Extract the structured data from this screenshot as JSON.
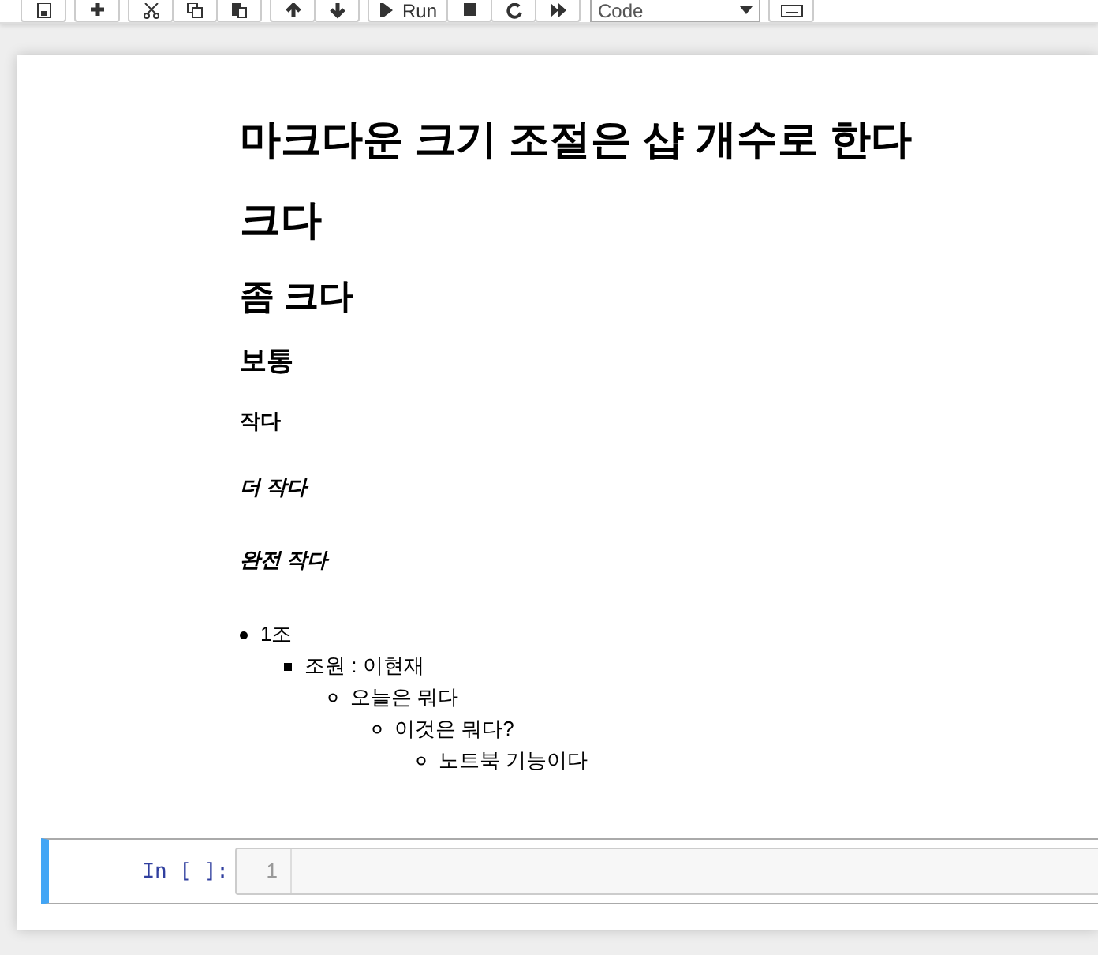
{
  "toolbar": {
    "run_label": "Run",
    "cell_type": "Code"
  },
  "markdown": {
    "headings": [
      {
        "kind": "h1",
        "text": "마크다운 크기 조절은 샵 개수로 한다"
      },
      {
        "kind": "h1",
        "text": "크다"
      },
      {
        "kind": "h2",
        "text": "좀 크다"
      },
      {
        "kind": "h3",
        "text": "보통"
      },
      {
        "kind": "h4",
        "text": "작다"
      },
      {
        "kind": "h5",
        "text": "더 작다"
      },
      {
        "kind": "h6",
        "text": "완전 작다"
      }
    ],
    "list": [
      {
        "text": "1조",
        "children": [
          {
            "text": "조원 : 이현재",
            "children": [
              {
                "text": "오늘은 뭐다",
                "children": [
                  {
                    "text": "이것은 뭐다?",
                    "children": [
                      {
                        "text": "노트북 기능이다"
                      }
                    ]
                  }
                ]
              }
            ]
          }
        ]
      }
    ]
  },
  "code_cell": {
    "prompt": "In [ ]:",
    "line_number": "1",
    "selected": true
  }
}
